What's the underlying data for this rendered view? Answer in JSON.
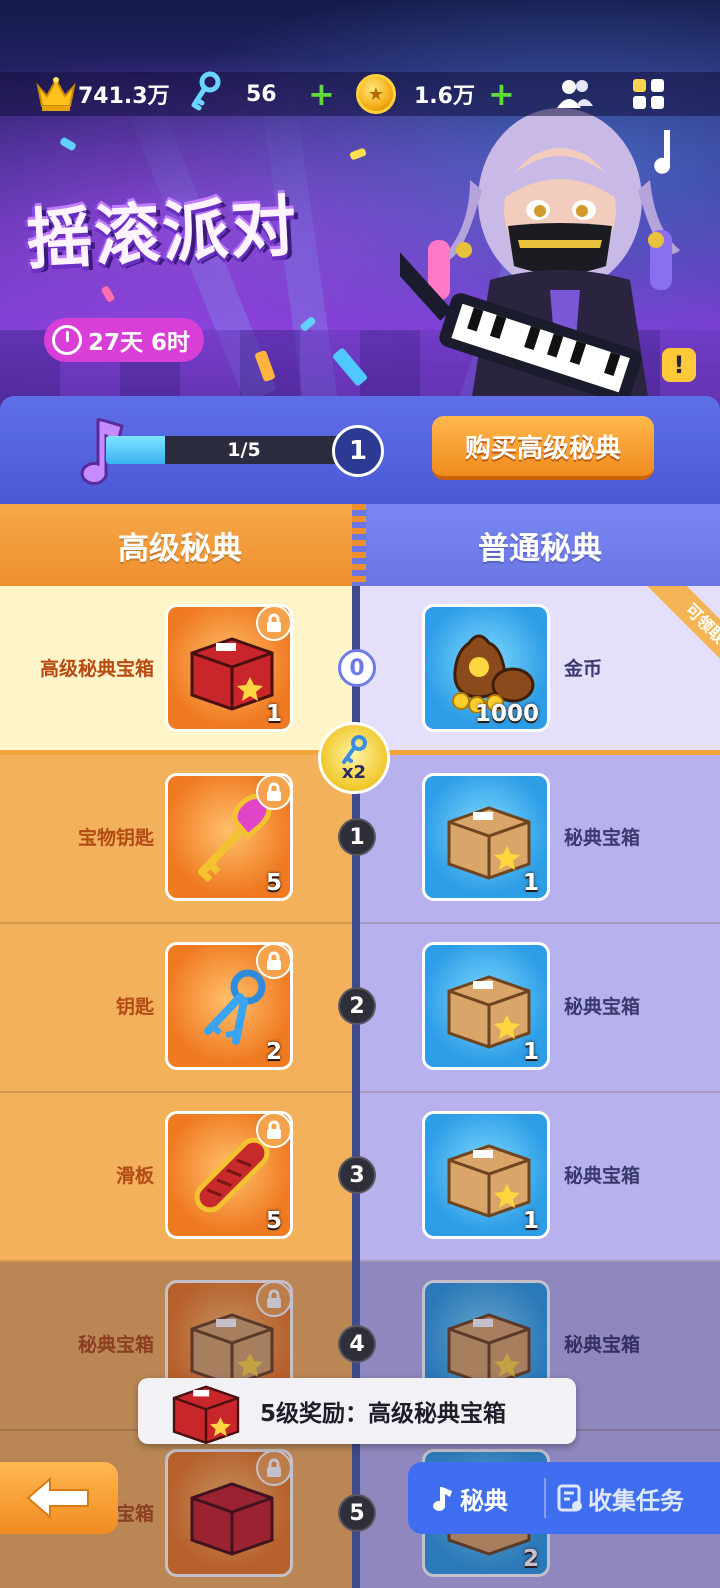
{
  "resources": {
    "crown_value": "741.3万",
    "keys_value": "56",
    "coins_value": "1.6万",
    "plus_symbol": "+"
  },
  "banner": {
    "title": "摇滚派对",
    "timer": "27天 6时",
    "info_symbol": "!"
  },
  "progress": {
    "text": "1/5",
    "fill_fraction": 0.25,
    "level": "1",
    "buy_label": "购买高级秘典"
  },
  "headers": {
    "premium": "高级秘典",
    "normal": "普通秘典"
  },
  "key_bonus": "x2",
  "claim_ribbon": "可领取",
  "rows": [
    {
      "level": "0",
      "premium_label": "高级秘典宝箱",
      "premium_qty": "1",
      "premium_icon": "red-chest-icon",
      "normal_label": "金币",
      "normal_qty": "1000",
      "normal_icon": "coin-bag-icon"
    },
    {
      "level": "1",
      "premium_label": "宝物钥匙",
      "premium_qty": "5",
      "premium_icon": "treasure-key-icon",
      "normal_label": "秘典宝箱",
      "normal_qty": "1",
      "normal_icon": "wooden-chest-icon"
    },
    {
      "level": "2",
      "premium_label": "钥匙",
      "premium_qty": "2",
      "premium_icon": "keys-icon",
      "normal_label": "秘典宝箱",
      "normal_qty": "1",
      "normal_icon": "wooden-chest-icon"
    },
    {
      "level": "3",
      "premium_label": "滑板",
      "premium_qty": "5",
      "premium_icon": "skateboard-icon",
      "normal_label": "秘典宝箱",
      "normal_qty": "1",
      "normal_icon": "wooden-chest-icon"
    },
    {
      "level": "4",
      "premium_label": "秘典宝箱",
      "premium_qty": "",
      "premium_icon": "wooden-chest-icon",
      "normal_label": "秘典宝箱",
      "normal_qty": "",
      "normal_icon": "wooden-chest-icon"
    },
    {
      "level": "5",
      "premium_label": "宝箱",
      "premium_qty": "",
      "premium_icon": "red-chest-icon",
      "normal_label": "",
      "normal_qty": "2",
      "normal_icon": "wooden-chest-icon"
    }
  ],
  "toast": {
    "text": "5级奖励：高级秘典宝箱"
  },
  "nav": {
    "active_tab": "秘典",
    "inactive_tab": "收集任务"
  },
  "colors": {
    "premium": "#f3b15b",
    "normal": "#b7b2ee",
    "accent_orange": "#f08a1e",
    "accent_blue": "#3f6ff0"
  }
}
